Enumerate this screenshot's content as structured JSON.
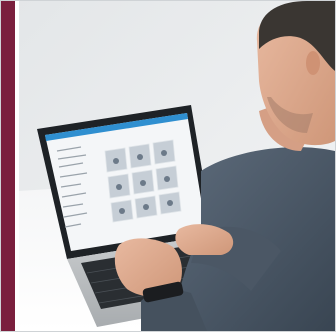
{
  "photo": {
    "subject": "person-typing-on-laptop",
    "accent_color": "#7a1f3d",
    "background_color": "#e7eaec",
    "laptop_screen_accent": "#2f8fd0"
  }
}
